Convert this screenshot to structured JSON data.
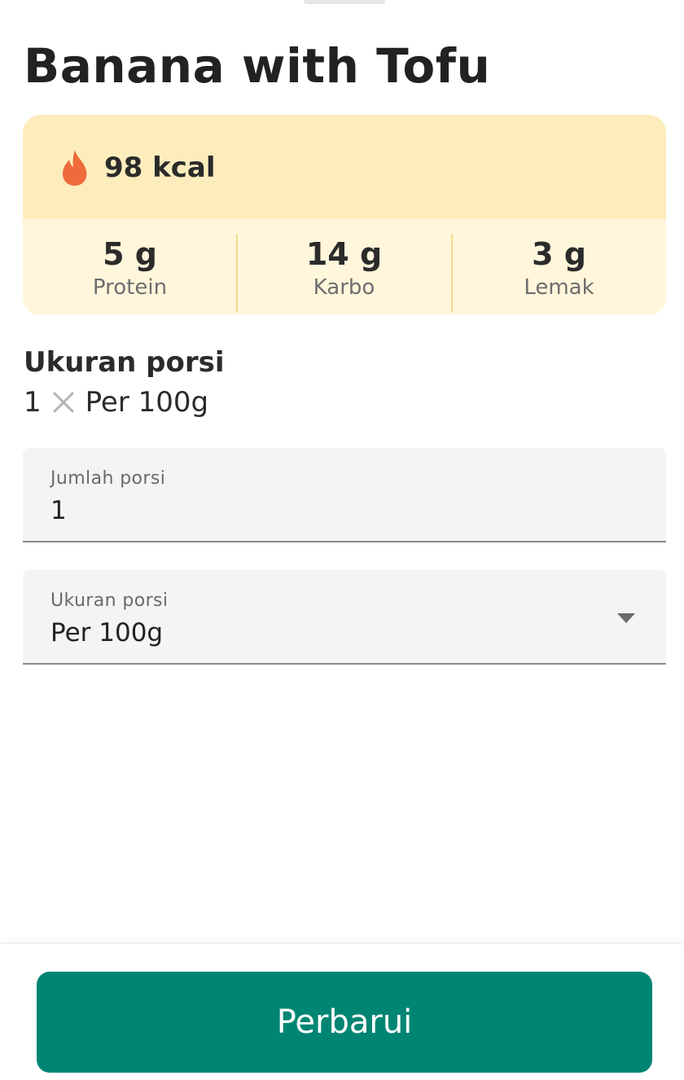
{
  "food": {
    "title": "Banana with Tofu"
  },
  "nutrition": {
    "calories": "98 kcal",
    "macros": [
      {
        "value": "5 g",
        "label": "Protein"
      },
      {
        "value": "14 g",
        "label": "Karbo"
      },
      {
        "value": "3 g",
        "label": "Lemak"
      }
    ]
  },
  "serving": {
    "heading": "Ukuran porsi",
    "count": "1",
    "unit": "Per 100g"
  },
  "form": {
    "servings_field": {
      "label": "Jumlah porsi",
      "value": "1"
    },
    "size_field": {
      "label": "Ukuran porsi",
      "value": "Per 100g"
    }
  },
  "footer": {
    "update_label": "Perbarui"
  },
  "colors": {
    "primary": "#008573",
    "kcal_bg": "#fdedbd",
    "macro_bg": "#fff6dc",
    "flame": "#f06b3c"
  }
}
